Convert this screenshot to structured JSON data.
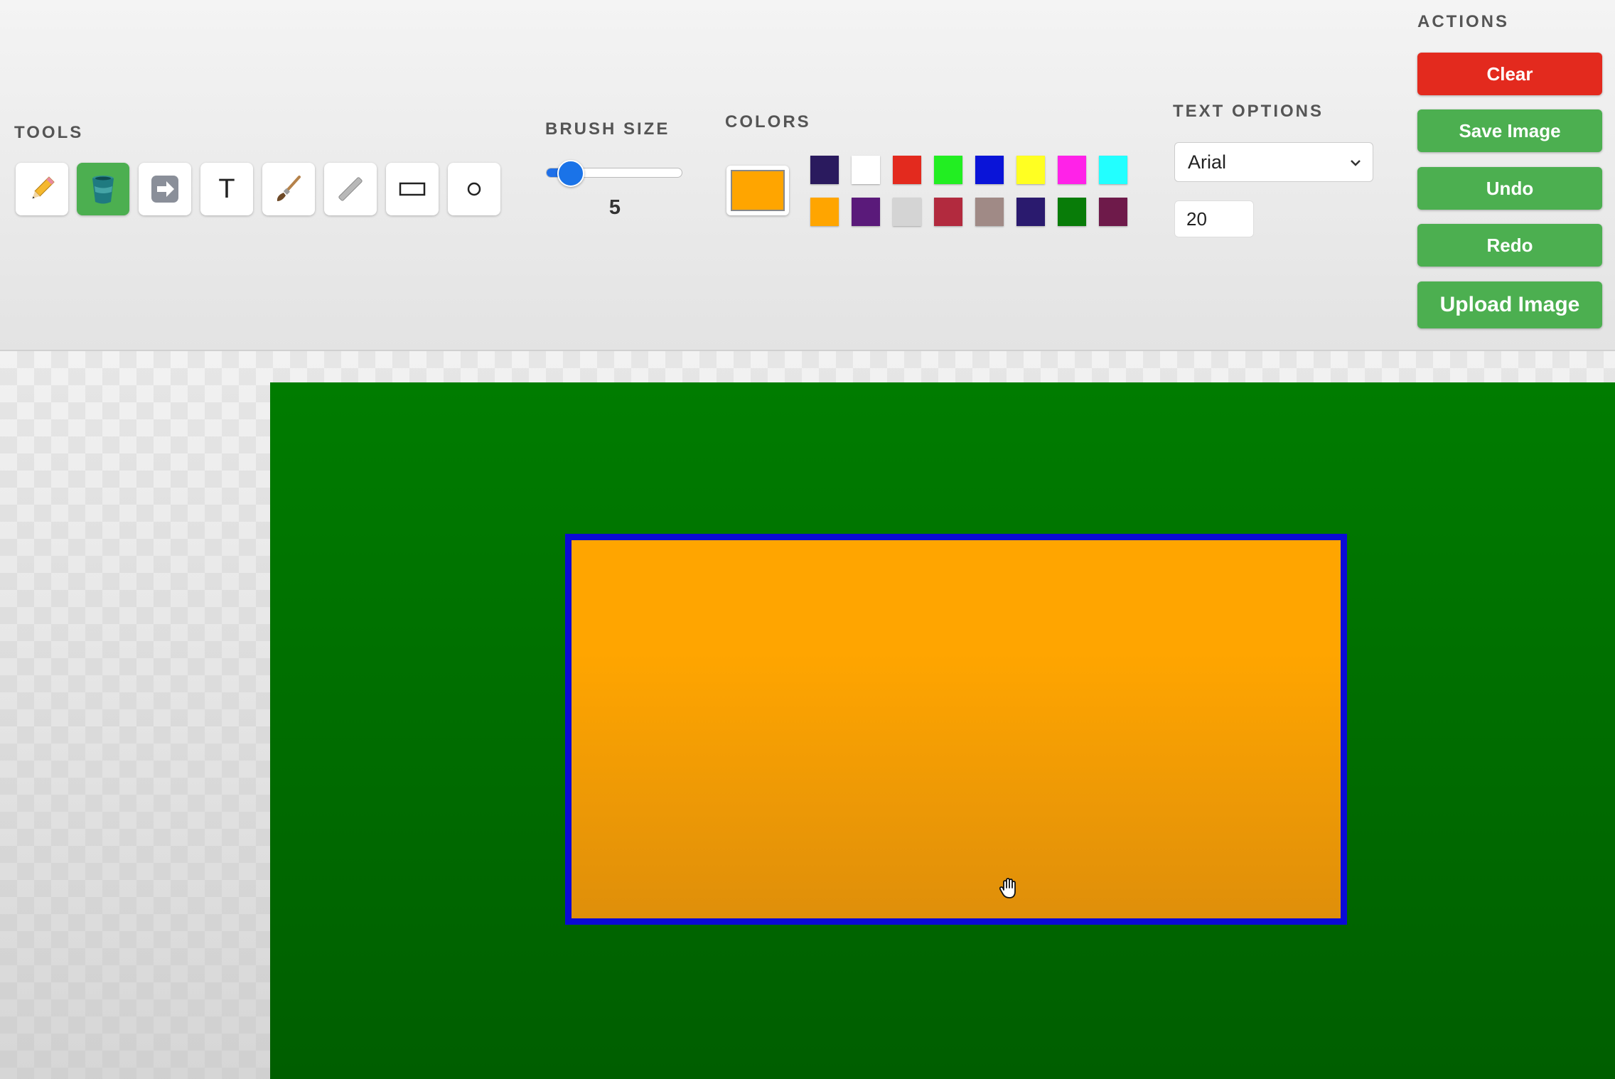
{
  "tools": {
    "title": "TOOLS",
    "items": [
      {
        "name": "pencil",
        "icon": "pencil-icon",
        "active": false
      },
      {
        "name": "fill-bucket",
        "icon": "bucket-icon",
        "active": true
      },
      {
        "name": "arrow",
        "icon": "arrow-right-icon",
        "active": false
      },
      {
        "name": "text",
        "icon": "text-icon",
        "label": "T",
        "active": false
      },
      {
        "name": "brush",
        "icon": "brush-icon",
        "active": false
      },
      {
        "name": "line",
        "icon": "line-icon",
        "active": false
      },
      {
        "name": "rectangle",
        "icon": "rectangle-icon",
        "active": false
      },
      {
        "name": "circle",
        "icon": "circle-icon",
        "active": false
      }
    ]
  },
  "brush": {
    "title": "BRUSH SIZE",
    "value": "5",
    "min": 1,
    "max": 50
  },
  "colors": {
    "title": "COLORS",
    "current": "#ffa500",
    "palette": [
      "#2a1a5e",
      "#ffffff",
      "#e32a1e",
      "#22ee22",
      "#0a14d8",
      "#ffff22",
      "#ff22e8",
      "#22ffff",
      "#ffa500",
      "#5a1a7a",
      "#d4d4d4",
      "#b22a3e",
      "#a08a86",
      "#2a1a6e",
      "#087c08",
      "#6e1a4a"
    ]
  },
  "text_options": {
    "title": "TEXT OPTIONS",
    "font": "Arial",
    "size": "20"
  },
  "actions": {
    "title": "ACTIONS",
    "clear": "Clear",
    "save": "Save Image",
    "undo": "Undo",
    "redo": "Redo",
    "upload": "Upload Image"
  },
  "canvas": {
    "background": "#007c00",
    "shape_fill": "#ffa500",
    "shape_stroke": "#0a0ad6"
  }
}
